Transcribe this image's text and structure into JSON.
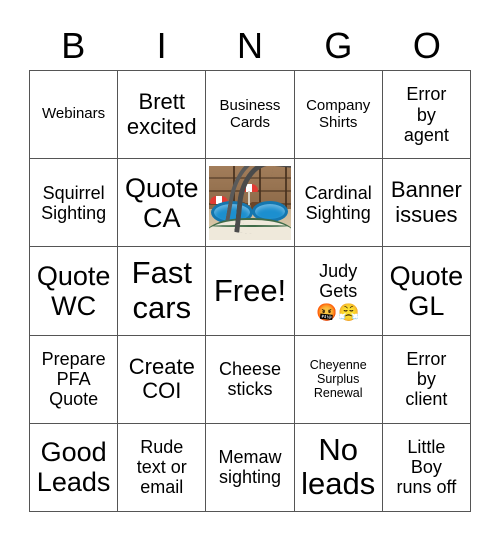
{
  "header": {
    "letters": [
      "B",
      "I",
      "N",
      "G",
      "O"
    ]
  },
  "grid": {
    "rows": [
      [
        {
          "text": "Webinars",
          "size": "fs-sm",
          "type": "text"
        },
        {
          "text": "Brett\nexcited",
          "size": "fs-lg",
          "type": "text"
        },
        {
          "text": "Business\nCards",
          "size": "fs-sm",
          "type": "text"
        },
        {
          "text": "Company\nShirts",
          "size": "fs-sm",
          "type": "text"
        },
        {
          "text": "Error\nby\nagent",
          "size": "fs-md",
          "type": "text"
        }
      ],
      [
        {
          "text": "Squirrel\nSighting",
          "size": "fs-md",
          "type": "text"
        },
        {
          "text": "Quote\nCA",
          "size": "fs-xl",
          "type": "text"
        },
        {
          "text": "",
          "size": "fs-sm",
          "type": "photo",
          "photo_alt": "patio-with-blue-pools-and-umbrellas"
        },
        {
          "text": "Cardinal\nSighting",
          "size": "fs-md",
          "type": "text"
        },
        {
          "text": "Banner\nissues",
          "size": "fs-lg",
          "type": "text"
        }
      ],
      [
        {
          "text": "Quote\nWC",
          "size": "fs-xl",
          "type": "text"
        },
        {
          "text": "Fast\ncars",
          "size": "fs-xxl",
          "type": "text"
        },
        {
          "text": "Free!",
          "size": "fs-xxl",
          "type": "text"
        },
        {
          "text": "Judy\nGets",
          "size": "fs-md",
          "type": "text",
          "emoji": "🤬😤"
        },
        {
          "text": "Quote\nGL",
          "size": "fs-xl",
          "type": "text"
        }
      ],
      [
        {
          "text": "Prepare\nPFA\nQuote",
          "size": "fs-md",
          "type": "text"
        },
        {
          "text": "Create\nCOI",
          "size": "fs-lg",
          "type": "text"
        },
        {
          "text": "Cheese\nsticks",
          "size": "fs-md",
          "type": "text"
        },
        {
          "text": "Cheyenne\nSurplus\nRenewal",
          "size": "fs-xs",
          "type": "text"
        },
        {
          "text": "Error\nby\nclient",
          "size": "fs-md",
          "type": "text"
        }
      ],
      [
        {
          "text": "Good\nLeads",
          "size": "fs-xl",
          "type": "text"
        },
        {
          "text": "Rude\ntext or\nemail",
          "size": "fs-md",
          "type": "text"
        },
        {
          "text": "Memaw\nsighting",
          "size": "fs-md",
          "type": "text"
        },
        {
          "text": "No\nleads",
          "size": "fs-xxl",
          "type": "text"
        },
        {
          "text": "Little\nBoy\nruns off",
          "size": "fs-md",
          "type": "text"
        }
      ]
    ]
  },
  "colors": {
    "background": "#ffffff",
    "text": "#000000",
    "border": "#555555"
  }
}
